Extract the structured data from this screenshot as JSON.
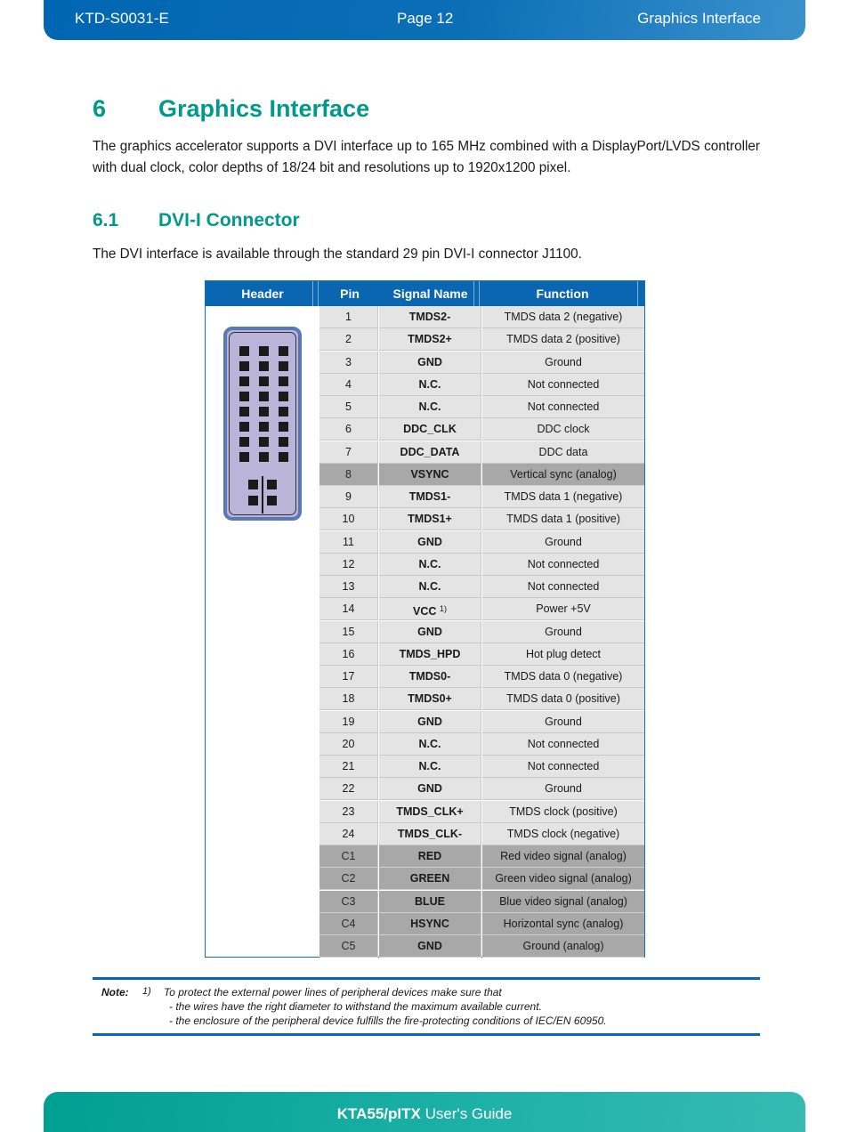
{
  "header": {
    "doc_id": "KTD-S0031-E",
    "page": "Page 12",
    "section": "Graphics Interface"
  },
  "chapter": {
    "number": "6",
    "title": "Graphics Interface",
    "intro": "The graphics accelerator supports a DVI interface up to 165 MHz combined with a DisplayPort/LVDS controller with dual clock, color depths of 18/24 bit and resolutions up to 1920x1200 pixel."
  },
  "section": {
    "number": "6.1",
    "title": "DVI-I Connector",
    "intro": "The DVI interface is available through the standard 29 pin DVI-I connector J1100."
  },
  "table": {
    "columns": [
      "Header",
      "Pin",
      "Signal Name",
      "Function"
    ],
    "connector_icon": "dvi-i-connector-icon",
    "rows": [
      {
        "pin": "1",
        "signal": "TMDS2-",
        "function": "TMDS data 2 (negative)",
        "analog": false
      },
      {
        "pin": "2",
        "signal": "TMDS2+",
        "function": "TMDS data 2 (positive)",
        "analog": false
      },
      {
        "pin": "3",
        "signal": "GND",
        "function": "Ground",
        "analog": false
      },
      {
        "pin": "4",
        "signal": "N.C.",
        "function": "Not connected",
        "analog": false
      },
      {
        "pin": "5",
        "signal": "N.C.",
        "function": "Not connected",
        "analog": false
      },
      {
        "pin": "6",
        "signal": "DDC_CLK",
        "function": "DDC clock",
        "analog": false
      },
      {
        "pin": "7",
        "signal": "DDC_DATA",
        "function": "DDC data",
        "analog": false
      },
      {
        "pin": "8",
        "signal": "VSYNC",
        "function": "Vertical sync (analog)",
        "analog": true
      },
      {
        "pin": "9",
        "signal": "TMDS1-",
        "function": "TMDS data 1 (negative)",
        "analog": false
      },
      {
        "pin": "10",
        "signal": "TMDS1+",
        "function": "TMDS data 1 (positive)",
        "analog": false
      },
      {
        "pin": "11",
        "signal": "GND",
        "function": "Ground",
        "analog": false
      },
      {
        "pin": "12",
        "signal": "N.C.",
        "function": "Not connected",
        "analog": false
      },
      {
        "pin": "13",
        "signal": "N.C.",
        "function": "Not connected",
        "analog": false
      },
      {
        "pin": "14",
        "signal": "VCC",
        "footnote": "1)",
        "function": "Power +5V",
        "analog": false
      },
      {
        "pin": "15",
        "signal": "GND",
        "function": "Ground",
        "analog": false
      },
      {
        "pin": "16",
        "signal": "TMDS_HPD",
        "function": "Hot plug detect",
        "analog": false
      },
      {
        "pin": "17",
        "signal": "TMDS0-",
        "function": "TMDS data 0 (negative)",
        "analog": false
      },
      {
        "pin": "18",
        "signal": "TMDS0+",
        "function": "TMDS data 0 (positive)",
        "analog": false
      },
      {
        "pin": "19",
        "signal": "GND",
        "function": "Ground",
        "analog": false
      },
      {
        "pin": "20",
        "signal": "N.C.",
        "function": "Not connected",
        "analog": false
      },
      {
        "pin": "21",
        "signal": "N.C.",
        "function": "Not connected",
        "analog": false
      },
      {
        "pin": "22",
        "signal": "GND",
        "function": "Ground",
        "analog": false
      },
      {
        "pin": "23",
        "signal": "TMDS_CLK+",
        "function": "TMDS clock (positive)",
        "analog": false
      },
      {
        "pin": "24",
        "signal": "TMDS_CLK-",
        "function": "TMDS clock (negative)",
        "analog": false
      },
      {
        "pin": "C1",
        "signal": "RED",
        "function": "Red video signal (analog)",
        "analog": true
      },
      {
        "pin": "C2",
        "signal": "GREEN",
        "function": "Green video signal (analog)",
        "analog": true
      },
      {
        "pin": "C3",
        "signal": "BLUE",
        "function": "Blue video signal (analog)",
        "analog": true
      },
      {
        "pin": "C4",
        "signal": "HSYNC",
        "function": "Horizontal sync (analog)",
        "analog": true
      },
      {
        "pin": "C5",
        "signal": "GND",
        "function": "Ground (analog)",
        "analog": true
      }
    ]
  },
  "note": {
    "label": "Note:",
    "number": "1)",
    "line1": "To protect the external power lines of peripheral devices make sure that",
    "line2": "- the wires have the right diameter to withstand the maximum available current.",
    "line3": "- the enclosure of the peripheral device fulfills the fire-protecting conditions of IEC/EN 60950."
  },
  "footer": {
    "product": "KTA55/pITX",
    "guide": " User's Guide"
  },
  "colors": {
    "header_blue": "#0066b1",
    "heading_teal": "#009a8a",
    "footer_teal": "#1fb2a8",
    "analog_row_gray": "#a8a8a8",
    "digital_row_gray": "#e4e4e4"
  }
}
